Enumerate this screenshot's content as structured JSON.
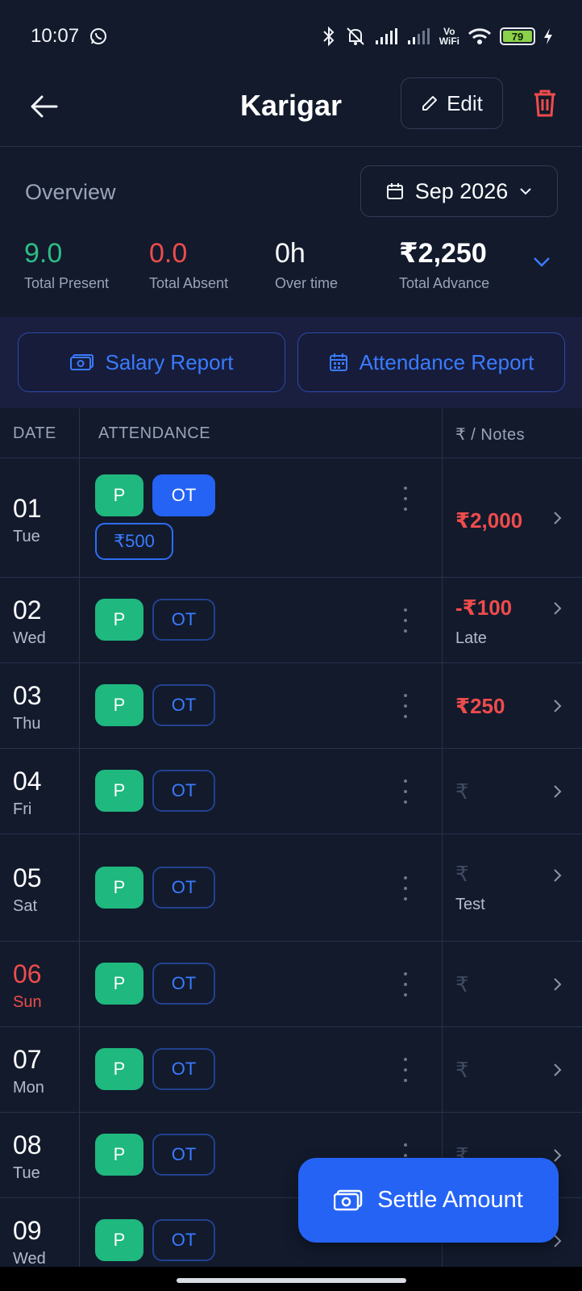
{
  "status_bar": {
    "time": "10:07",
    "battery": "79",
    "vowifi_top": "Vo",
    "vowifi_bottom": "WiFi",
    "icons": [
      "whatsapp-icon",
      "bluetooth-icon",
      "mute-icon",
      "signal-icon",
      "signal-icon",
      "vowifi-icon",
      "wifi-icon",
      "battery-icon",
      "charging-icon"
    ]
  },
  "header": {
    "title": "Karigar",
    "edit_label": "Edit",
    "back_icon": "arrow-left-icon",
    "delete_icon": "trash-icon"
  },
  "overview": {
    "label": "Overview",
    "month": "Sep 2026",
    "stats": {
      "present": {
        "value": "9.0",
        "label": "Total Present"
      },
      "absent": {
        "value": "0.0",
        "label": "Total Absent"
      },
      "overtime": {
        "value": "0h",
        "label": "Over time"
      },
      "advance": {
        "value": "₹2,250",
        "label": "Total Advance"
      }
    }
  },
  "reports": {
    "salary_label": "Salary Report",
    "attendance_label": "Attendance Report"
  },
  "table": {
    "headers": {
      "date": "DATE",
      "attendance": "ATTENDANCE",
      "notes": "₹ / Notes"
    },
    "rows": [
      {
        "day": "01",
        "weekday": "Tue",
        "present": "P",
        "ot": "OT",
        "ot_active": true,
        "ot_amount": "₹500",
        "amount": "₹2,000",
        "note": ""
      },
      {
        "day": "02",
        "weekday": "Wed",
        "present": "P",
        "ot": "OT",
        "amount": "-₹100",
        "note": "Late"
      },
      {
        "day": "03",
        "weekday": "Thu",
        "present": "P",
        "ot": "OT",
        "amount": "₹250",
        "note": ""
      },
      {
        "day": "04",
        "weekday": "Fri",
        "present": "P",
        "ot": "OT",
        "amount": "₹",
        "note": ""
      },
      {
        "day": "05",
        "weekday": "Sat",
        "present": "P",
        "ot": "OT",
        "amount": "₹",
        "note": "Test"
      },
      {
        "day": "06",
        "weekday": "Sun",
        "present": "P",
        "ot": "OT",
        "amount": "₹",
        "note": ""
      },
      {
        "day": "07",
        "weekday": "Mon",
        "present": "P",
        "ot": "OT",
        "amount": "₹",
        "note": ""
      },
      {
        "day": "08",
        "weekday": "Tue",
        "present": "P",
        "ot": "OT",
        "amount": "₹",
        "note": ""
      },
      {
        "day": "09",
        "weekday": "Wed",
        "present": "P",
        "ot": "OT",
        "amount": "",
        "note": ""
      }
    ]
  },
  "fab": {
    "label": "Settle Amount"
  },
  "colors": {
    "background": "#121a2c",
    "present_green": "#1fb87e",
    "absent_red": "#ee4c4c",
    "accent_blue": "#2563f5",
    "report_band": "#1a1f3f"
  }
}
